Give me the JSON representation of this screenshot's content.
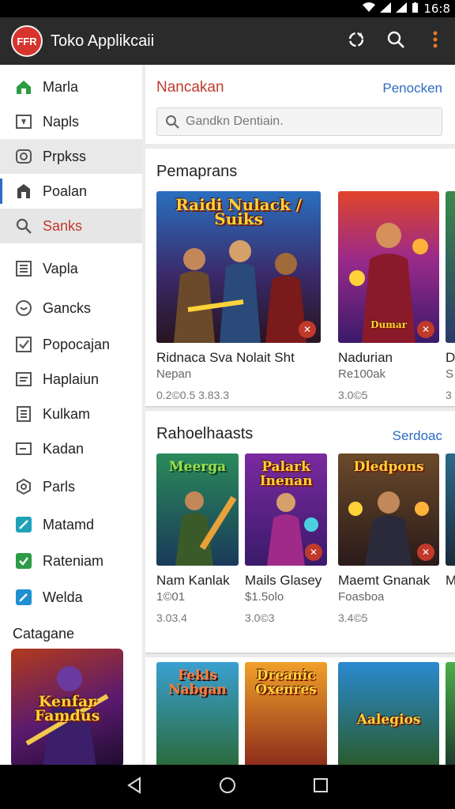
{
  "status": {
    "time": "16:8"
  },
  "app": {
    "logo_text": "FFR",
    "title": "Toko Applikcaii"
  },
  "sidebar": {
    "items": [
      {
        "label": "Marla"
      },
      {
        "label": "Napls"
      },
      {
        "label": "Prpkss"
      },
      {
        "label": "Poalan"
      },
      {
        "label": "Sanks"
      },
      {
        "label": "Vapla"
      },
      {
        "label": "Gancks"
      },
      {
        "label": "Popocajan"
      },
      {
        "label": "Haplaiun"
      },
      {
        "label": "Kulkam"
      },
      {
        "label": "Kadan"
      },
      {
        "label": "Parls"
      },
      {
        "label": "Matamd"
      },
      {
        "label": "Rateniam"
      },
      {
        "label": "Welda"
      }
    ],
    "section_label": "Catagane",
    "art_title": "Kenfar Famdus"
  },
  "search_card": {
    "title": "Nancakan",
    "link": "Penocken",
    "placeholder": "Gandkn Dentiain."
  },
  "sections": [
    {
      "title": "Pemaprans",
      "link": "",
      "tiles": [
        {
          "art": "Raidi Nulack / Suiks",
          "name": "Ridnaca Sva Nolait Sht",
          "sub": "Nepan",
          "price": "0.2©0.5  3.83.3"
        },
        {
          "art": "Dumar",
          "name": "Nadurian",
          "sub": "Re100ak",
          "price": "3.0©5"
        },
        {
          "art": "",
          "name": "D",
          "sub": "S",
          "price": "3"
        }
      ]
    },
    {
      "title": "Rahoelhaasts",
      "link": "Serdoac",
      "tiles": [
        {
          "art": "Meerga",
          "name": "Nam Kanlak",
          "sub": "1©01",
          "price": "3.03.4"
        },
        {
          "art": "Palark Inenan",
          "name": "Mails Glasey",
          "sub": "$1.5olo",
          "price": "3.0©3"
        },
        {
          "art": "Dledpons",
          "name": "Maemt Gnanak",
          "sub": "Foasboa",
          "price": "3.4©5"
        },
        {
          "art": "",
          "name": "M",
          "sub": "",
          "price": ""
        }
      ]
    },
    {
      "title": "",
      "link": "",
      "tiles": [
        {
          "art": "Fekls Nabgan"
        },
        {
          "art": "Dreanic Oxenres"
        },
        {
          "art": "Aalegios"
        }
      ]
    }
  ],
  "colors": {
    "accent": "#c0392b",
    "link": "#2d6cc3",
    "appbar": "#2b2b2b"
  }
}
